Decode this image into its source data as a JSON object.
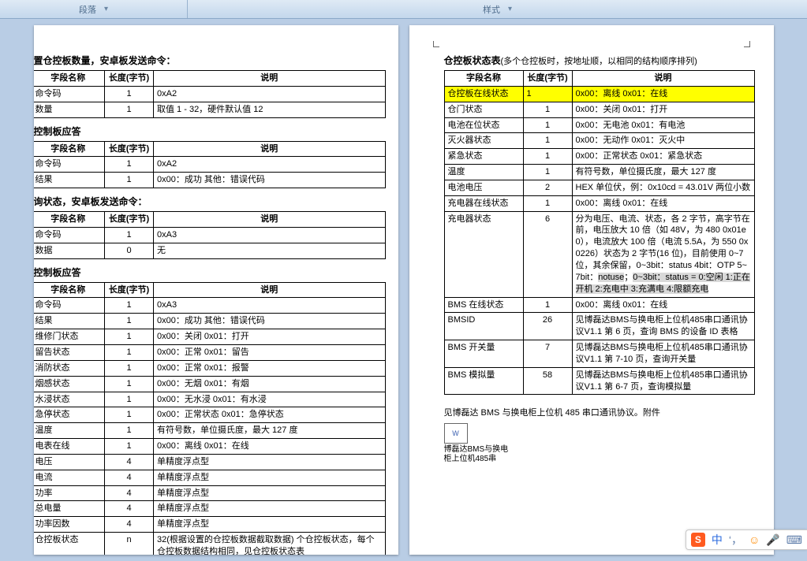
{
  "ribbon": {
    "group_paragraph": "段落",
    "group_styles": "样式",
    "expand_glyph": "▾"
  },
  "doc": {
    "left": {
      "sec1_title": "置仓控板数量，安卓板发送命令：",
      "sec2_title": "控制板应答",
      "sec3_title": "询状态，安卓板发送命令：",
      "sec4_title": "控制板应答",
      "headers": {
        "name": "字段名称",
        "len": "长度(字节)",
        "desc": "说明"
      },
      "t1": [
        {
          "name": "命令码",
          "len": "1",
          "desc": "0xA2"
        },
        {
          "name": "数量",
          "len": "1",
          "desc": "取值 1 - 32，硬件默认值 12"
        }
      ],
      "t2": [
        {
          "name": "命令码",
          "len": "1",
          "desc": "0xA2"
        },
        {
          "name": "结果",
          "len": "1",
          "desc": "0x00：成功   其他：错误代码"
        }
      ],
      "t3": [
        {
          "name": "命令码",
          "len": "1",
          "desc": "0xA3"
        },
        {
          "name": "数据",
          "len": "0",
          "desc": "无"
        }
      ],
      "t4": [
        {
          "name": "命令码",
          "len": "1",
          "desc": "0xA3"
        },
        {
          "name": "结果",
          "len": "1",
          "desc": "0x00：成功   其他：错误代码"
        },
        {
          "name": "维修门状态",
          "len": "1",
          "desc": "0x00：关闭   0x01：打开"
        },
        {
          "name": "留告状态",
          "len": "1",
          "desc": "0x00：正常   0x01：留告"
        },
        {
          "name": "消防状态",
          "len": "1",
          "desc": "0x00：正常   0x01：报警"
        },
        {
          "name": "烟感状态",
          "len": "1",
          "desc": "0x00：无烟   0x01：有烟"
        },
        {
          "name": "水浸状态",
          "len": "1",
          "desc": "0x00：无水浸   0x01：有水浸"
        },
        {
          "name": "急停状态",
          "len": "1",
          "desc": "0x00：正常状态   0x01：急停状态"
        },
        {
          "name": "温度",
          "len": "1",
          "desc": "有符号数，单位摄氏度，最大 127 度"
        },
        {
          "name": "电表在线",
          "len": "1",
          "desc": "0x00：离线   0x01：在线"
        },
        {
          "name": "电压",
          "len": "4",
          "desc": "单精度浮点型"
        },
        {
          "name": "电流",
          "len": "4",
          "desc": "单精度浮点型"
        },
        {
          "name": "功率",
          "len": "4",
          "desc": "单精度浮点型"
        },
        {
          "name": "总电量",
          "len": "4",
          "desc": "单精度浮点型"
        },
        {
          "name": "功率因数",
          "len": "4",
          "desc": "单精度浮点型"
        },
        {
          "name": "仓控板状态",
          "len": "n",
          "desc": "32(根据设置的仓控板数据截取数据) 个仓控板状态，每个仓控板数据结构相同，见仓控板状态表"
        }
      ]
    },
    "right": {
      "title": "仓控板状态表",
      "title_note": "(多个仓控板时，按地址顺，以相同的结构顺序排列)",
      "headers": {
        "name": "字段名称",
        "len": "长度(字节)",
        "desc": "说明"
      },
      "rows": [
        {
          "name": "仓控板在线状态",
          "len": "1",
          "desc": "0x00：离线   0x01：在线",
          "hl": true
        },
        {
          "name": "仓门状态",
          "len": "1",
          "desc": "0x00：关闭   0x01：打开"
        },
        {
          "name": "电池在位状态",
          "len": "1",
          "desc": "0x00：无电池   0x01：有电池"
        },
        {
          "name": "灭火器状态",
          "len": "1",
          "desc": "0x00：无动作   0x01：灭火中"
        },
        {
          "name": "紧急状态",
          "len": "1",
          "desc": "0x00：正常状态   0x01：紧急状态"
        },
        {
          "name": "温度",
          "len": "1",
          "desc": "有符号数，单位摄氏度，最大 127 度"
        },
        {
          "name": "电池电压",
          "len": "2",
          "desc": "HEX 单位伏，例：0x10cd = 43.01V 两位小数"
        },
        {
          "name": "充电器在线状态",
          "len": "1",
          "desc": "0x00：离线   0x01：在线"
        },
        {
          "name": "充电器状态",
          "len": "6",
          "desc": "分为电压、电流、状态，各 2 字节，高字节在前，电压放大 10 倍（如 48V，为 480  0x01e0），电流放大 100 倍（电流 5.5A，为 550 0x0226）状态为 2 字节(16 位)，目前使用 0~7 位，其余保留，0~3bit：status 4bit：OTP  5~7bit：notuse；0~3bit：status = 0:空闲 1:正在开机 2:充电中 3:充满电  4:限额充电"
        },
        {
          "name": "BMS 在线状态",
          "len": "1",
          "desc": "0x00：离线   0x01：在线"
        },
        {
          "name": "BMSID",
          "len": "26",
          "desc": "见博磊达BMS与换电柜上位机485串口通讯协议V1.1 第 6 页，查询 BMS 的设备 ID 表格"
        },
        {
          "name": "BMS 开关量",
          "len": "7",
          "desc": "见博磊达BMS与换电柜上位机485串口通讯协议V1.1 第 7-10 页，查询开关量"
        },
        {
          "name": "BMS 模拟量",
          "len": "58",
          "desc": "见博磊达BMS与换电柜上位机485串口通讯协议V1.1 第 6-7 页，查询模拟量"
        }
      ],
      "attach_line": "见博磊达 BMS 与换电柜上位机 485 串口通讯协议。附件",
      "attach_name": "博磊达BMS与换电柜上位机485串"
    }
  },
  "ime": {
    "logo": "S",
    "zhong": "中",
    "comma": "‘，",
    "smile": "☺",
    "mic": "🎤",
    "kb": "⌨"
  }
}
